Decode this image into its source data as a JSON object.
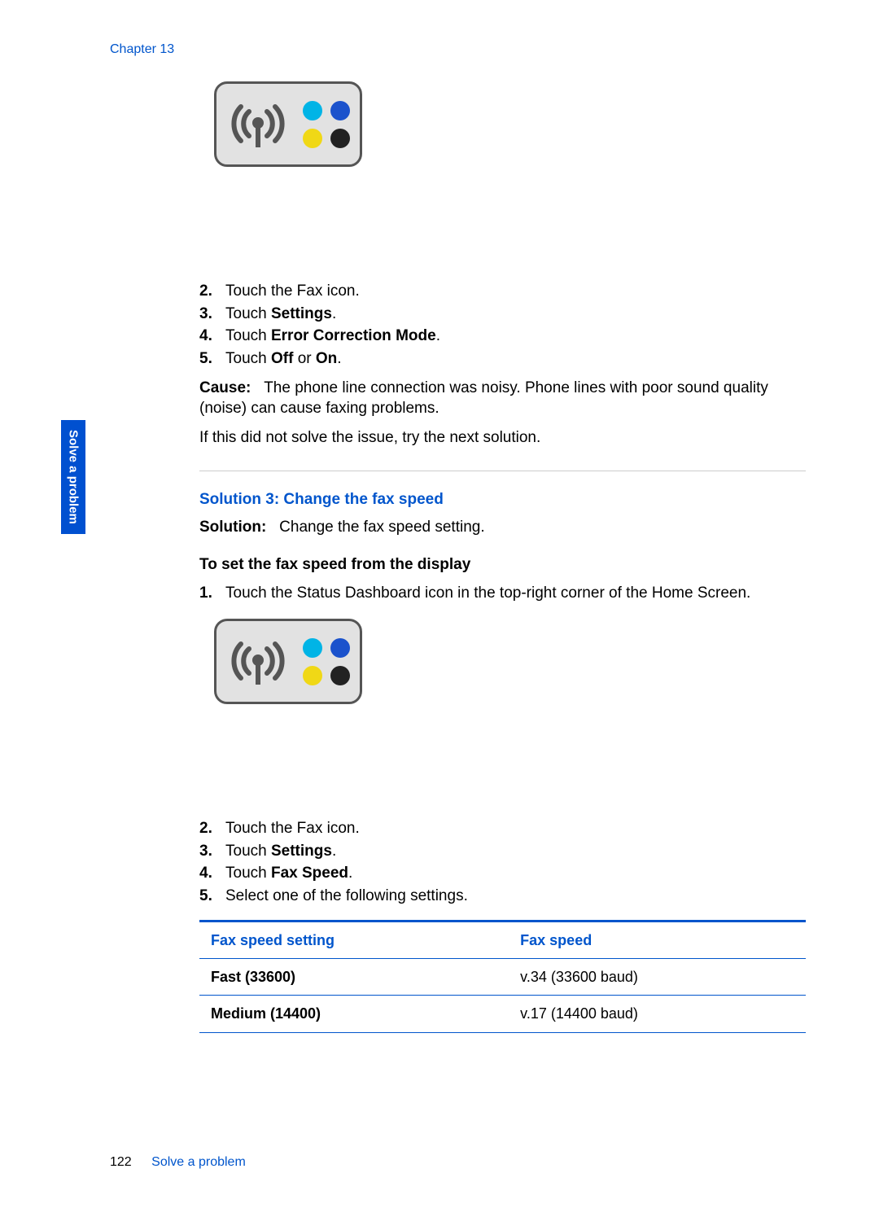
{
  "chapter_label": "Chapter 13",
  "side_tab": "Solve a problem",
  "steps_a": [
    {
      "n": "2.",
      "text": "Touch the Fax icon."
    },
    {
      "n": "3.",
      "pre": "Touch ",
      "bold": "Settings",
      "post": "."
    },
    {
      "n": "4.",
      "pre": "Touch ",
      "bold": "Error Correction Mode",
      "post": "."
    },
    {
      "n": "5.",
      "pre": "Touch ",
      "bold": "Off",
      "mid": " or ",
      "bold2": "On",
      "post": "."
    }
  ],
  "cause": {
    "label": "Cause:",
    "text": "The phone line connection was noisy. Phone lines with poor sound quality (noise) can cause faxing problems."
  },
  "followup": "If this did not solve the issue, try the next solution.",
  "solution3": {
    "heading": "Solution 3: Change the fax speed",
    "label": "Solution:",
    "text": "Change the fax speed setting.",
    "subheading": "To set the fax speed from the display",
    "steps_b_first": {
      "n": "1.",
      "text": "Touch the Status Dashboard icon in the top-right corner of the Home Screen."
    },
    "steps_b_rest": [
      {
        "n": "2.",
        "text": "Touch the Fax icon."
      },
      {
        "n": "3.",
        "pre": "Touch ",
        "bold": "Settings",
        "post": "."
      },
      {
        "n": "4.",
        "pre": "Touch ",
        "bold": "Fax Speed",
        "post": "."
      },
      {
        "n": "5.",
        "text": "Select one of the following settings."
      }
    ]
  },
  "table": {
    "head": [
      "Fax speed setting",
      "Fax speed"
    ],
    "rows": [
      [
        "Fast (33600)",
        "v.34 (33600 baud)"
      ],
      [
        "Medium (14400)",
        "v.17 (14400 baud)"
      ]
    ]
  },
  "footer": {
    "page": "122",
    "section": "Solve a problem"
  }
}
